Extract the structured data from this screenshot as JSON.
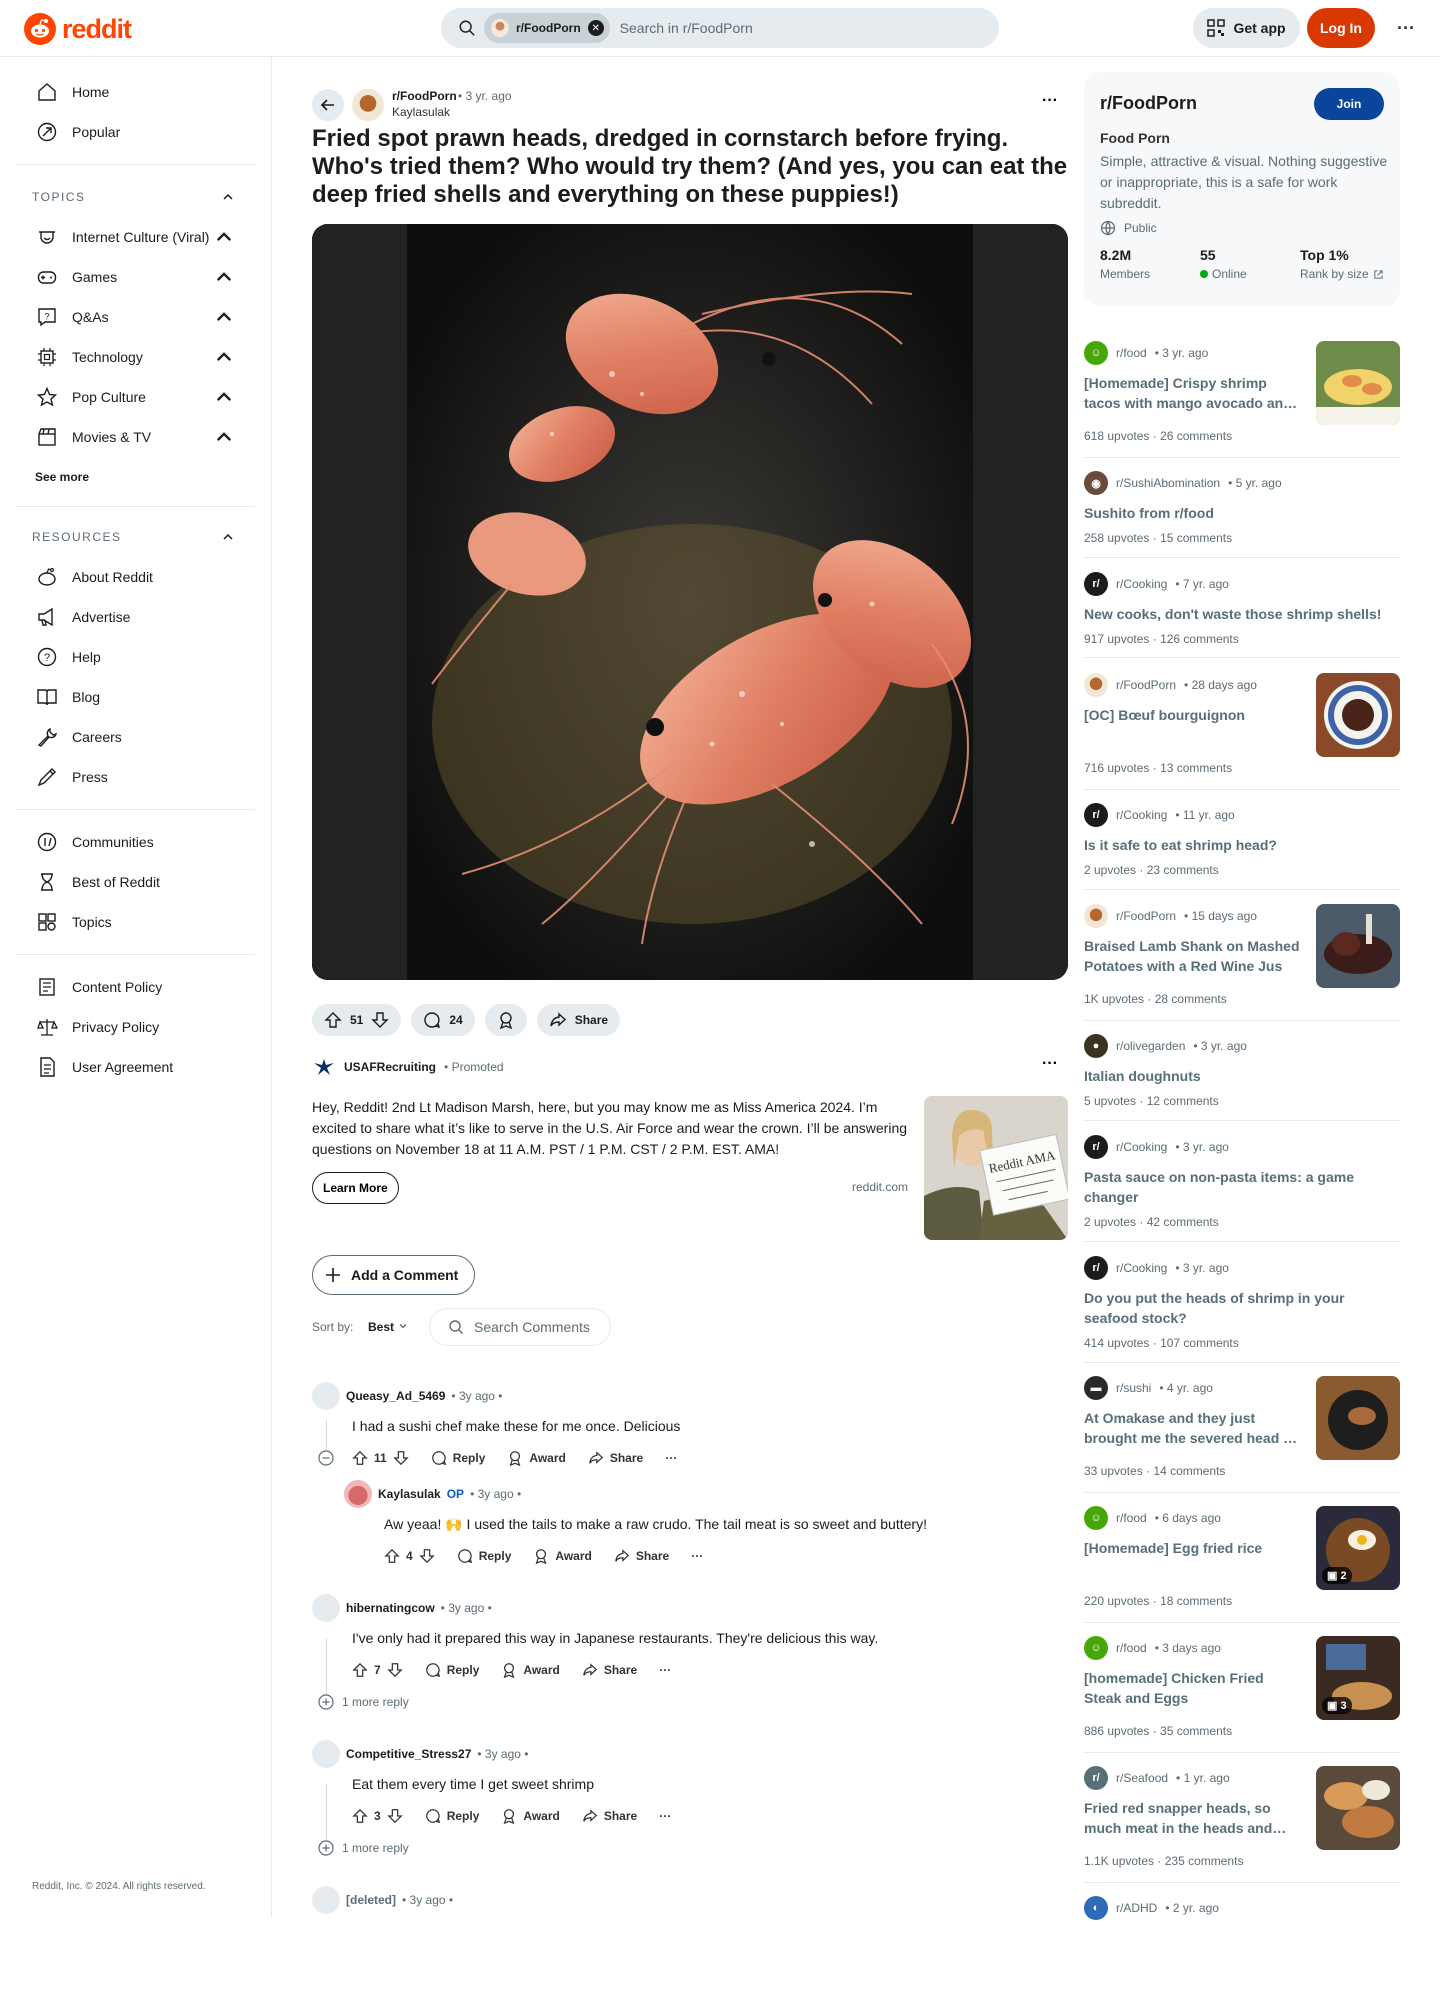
{
  "header": {
    "logo_text": "reddit",
    "search_chip": "r/FoodPorn",
    "search_placeholder": "Search in r/FoodPorn",
    "get_app": "Get app",
    "login": "Log In",
    "brand_color": "#ff4500"
  },
  "sidebar": {
    "home": "Home",
    "popular": "Popular",
    "topics_header": "TOPICS",
    "topics": [
      "Internet Culture (Viral)",
      "Games",
      "Q&As",
      "Technology",
      "Pop Culture",
      "Movies & TV"
    ],
    "see_more": "See more",
    "resources_header": "RESOURCES",
    "resources": [
      "About Reddit",
      "Advertise",
      "Help",
      "Blog",
      "Careers",
      "Press"
    ],
    "extra": [
      "Communities",
      "Best of Reddit",
      "Topics"
    ],
    "policies": [
      "Content Policy",
      "Privacy Policy",
      "User Agreement"
    ],
    "copyright": "Reddit, Inc. © 2024. All rights reserved."
  },
  "post": {
    "subreddit": "r/FoodPorn",
    "meta": "• 3 yr. ago",
    "author": "Kaylasulak",
    "title": "Fried spot prawn heads, dredged in cornstarch before frying. Who's tried them? Who would try them? (And yes, you can eat the deep fried shells and everything on these puppies!)",
    "upvotes": "51",
    "comments": "24",
    "share": "Share"
  },
  "ad": {
    "name": "USAFRecruiting",
    "promoted": "Promoted",
    "text": "Hey, Reddit! 2nd Lt Madison Marsh, here, but you may know me as Miss America 2024. I’m excited to share what it’s like to serve in the U.S. Air Force and wear the crown. I’ll be answering questions on November 18 at 11 A.M. PST / 1 P.M. CST / 2 P.M. EST. AMA!",
    "cta": "Learn More",
    "domain": "reddit.com",
    "sign_text": "Reddit AMA"
  },
  "comments_ui": {
    "add_comment": "Add a Comment",
    "sort_label": "Sort by:",
    "sort_value": "Best",
    "search_placeholder": "Search Comments",
    "reply": "Reply",
    "award": "Award",
    "share": "Share"
  },
  "comments": [
    {
      "user": "Queasy_Ad_5469",
      "meta": "• 3y ago •",
      "body": "I had a sushi chef make these for me once. Delicious",
      "votes": "11"
    },
    {
      "user": "Kaylasulak",
      "op": "OP",
      "meta": "• 3y ago •",
      "body": "Aw yeaa! 🙌 I used the tails to make a raw crudo. The tail meat is so sweet and buttery!",
      "votes": "4"
    },
    {
      "user": "hibernatingcow",
      "meta": "• 3y ago •",
      "body": "I've only had it prepared this way in Japanese restaurants. They're delicious this way.",
      "votes": "7",
      "more": "1 more reply"
    },
    {
      "user": "Competitive_Stress27",
      "meta": "• 3y ago •",
      "body": "Eat them every time I get sweet shrimp",
      "votes": "3",
      "more": "1 more reply"
    },
    {
      "user": "[deleted]",
      "meta": "• 3y ago •"
    }
  ],
  "community": {
    "title": "r/FoodPorn",
    "join": "Join",
    "name": "Food Porn",
    "description": "Simple, attractive & visual. Nothing suggestive or inappropriate, this is a safe for work subreddit.",
    "visibility": "Public",
    "members_value": "8.2M",
    "members_label": "Members",
    "online_value": "55",
    "online_label": "Online",
    "rank_value": "Top 1%",
    "rank_label": "Rank by size"
  },
  "related": [
    {
      "sub": "r/food",
      "age": "• 3 yr. ago",
      "title": "[Homemade] Crispy shrimp tacos with mango avocado an…",
      "upvotes": "618 upvotes",
      "comments": "26 comments"
    },
    {
      "sub": "r/SushiAbomination",
      "age": "• 5 yr. ago",
      "title": "Sushito from r/food",
      "upvotes": "258 upvotes",
      "comments": "15 comments"
    },
    {
      "sub": "r/Cooking",
      "age": "• 7 yr. ago",
      "title": "New cooks, don't waste those shrimp shells!",
      "upvotes": "917 upvotes",
      "comments": "126 comments"
    },
    {
      "sub": "r/FoodPorn",
      "age": "• 28 days ago",
      "title": "[OC] Bœuf bourguignon",
      "upvotes": "716 upvotes",
      "comments": "13 comments"
    },
    {
      "sub": "r/Cooking",
      "age": "• 11 yr. ago",
      "title": "Is it safe to eat shrimp head?",
      "upvotes": "2 upvotes",
      "comments": "23 comments"
    },
    {
      "sub": "r/FoodPorn",
      "age": "• 15 days ago",
      "title": "Braised Lamb Shank on Mashed Potatoes with a Red Wine Jus",
      "upvotes": "1K upvotes",
      "comments": "28 comments"
    },
    {
      "sub": "r/olivegarden",
      "age": "• 3 yr. ago",
      "title": "Italian doughnuts",
      "upvotes": "5 upvotes",
      "comments": "12 comments"
    },
    {
      "sub": "r/Cooking",
      "age": "• 3 yr. ago",
      "title": "Pasta sauce on non-pasta items: a game changer",
      "upvotes": "2 upvotes",
      "comments": "42 comments"
    },
    {
      "sub": "r/Cooking",
      "age": "• 3 yr. ago",
      "title": "Do you put the heads of shrimp in your seafood stock?",
      "upvotes": "414 upvotes",
      "comments": "107 comments"
    },
    {
      "sub": "r/sushi",
      "age": "• 4 yr. ago",
      "title": "At Omakase and they just brought me the severed head …",
      "upvotes": "33 upvotes",
      "comments": "14 comments"
    },
    {
      "sub": "r/food",
      "age": "• 6 days ago",
      "title": "[Homemade] Egg fried rice",
      "upvotes": "220 upvotes",
      "comments": "18 comments",
      "gallery": "2"
    },
    {
      "sub": "r/food",
      "age": "• 3 days ago",
      "title": "[homemade] Chicken Fried Steak and Eggs",
      "upvotes": "886 upvotes",
      "comments": "35 comments",
      "gallery": "3"
    },
    {
      "sub": "r/Seafood",
      "age": "• 1 yr. ago",
      "title": "Fried red snapper heads, so much meat in the heads and…",
      "upvotes": "1.1K upvotes",
      "comments": "235 comments"
    },
    {
      "sub": "r/ADHD",
      "age": "• 2 yr. ago"
    }
  ]
}
